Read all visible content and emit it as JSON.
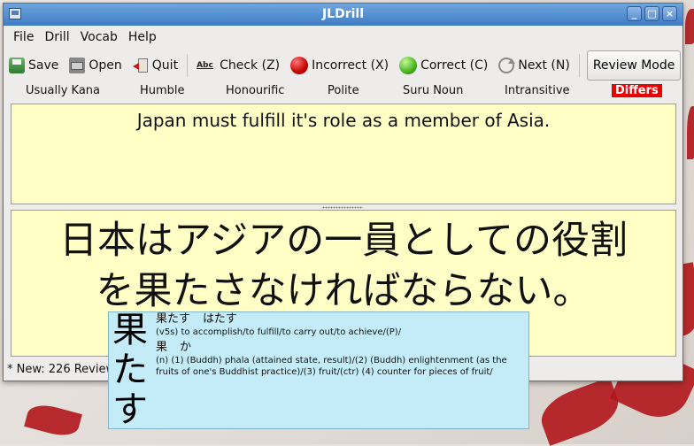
{
  "window": {
    "title": "JLDrill",
    "buttons": [
      "_",
      "□",
      "×"
    ]
  },
  "menu": [
    "File",
    "Drill",
    "Vocab",
    "Help"
  ],
  "toolbar": {
    "save": "Save",
    "open": "Open",
    "quit": "Quit",
    "check": "Check (Z)",
    "check_icon_text": "Abc",
    "incorrect": "Incorrect (X)",
    "correct": "Correct (C)",
    "next": "Next (N)",
    "review_mode": "Review Mode"
  },
  "tags": [
    "Usually Kana",
    "Humble",
    "Honourific",
    "Polite",
    "Suru Noun",
    "Intransitive",
    "Differs"
  ],
  "colors": {
    "differs_bg": "#ec0000",
    "panel_bg": "#ffffc6",
    "popup_bg": "#c3ebf8"
  },
  "question": "Japan must fulfill it's role as a member of Asia.",
  "answer": {
    "line1": "日本はアジアの一員としての役割",
    "line2": "を果たさなければならない。"
  },
  "status": "* New: 226 Review",
  "popup": {
    "kanji": [
      "果",
      "た",
      "す"
    ],
    "entries": [
      {
        "word": "果たす",
        "reading": "はたす",
        "definition": "(v5s) to accomplish/to fulfill/to carry out/to achieve/(P)/"
      },
      {
        "word": "果",
        "reading": "か",
        "definition": "(n) (1) (Buddh) phala (attained state, result)/(2) (Buddh) enlightenment (as the fruits of one's Buddhist practice)/(3) fruit/(ctr) (4) counter for pieces of fruit/"
      }
    ]
  }
}
